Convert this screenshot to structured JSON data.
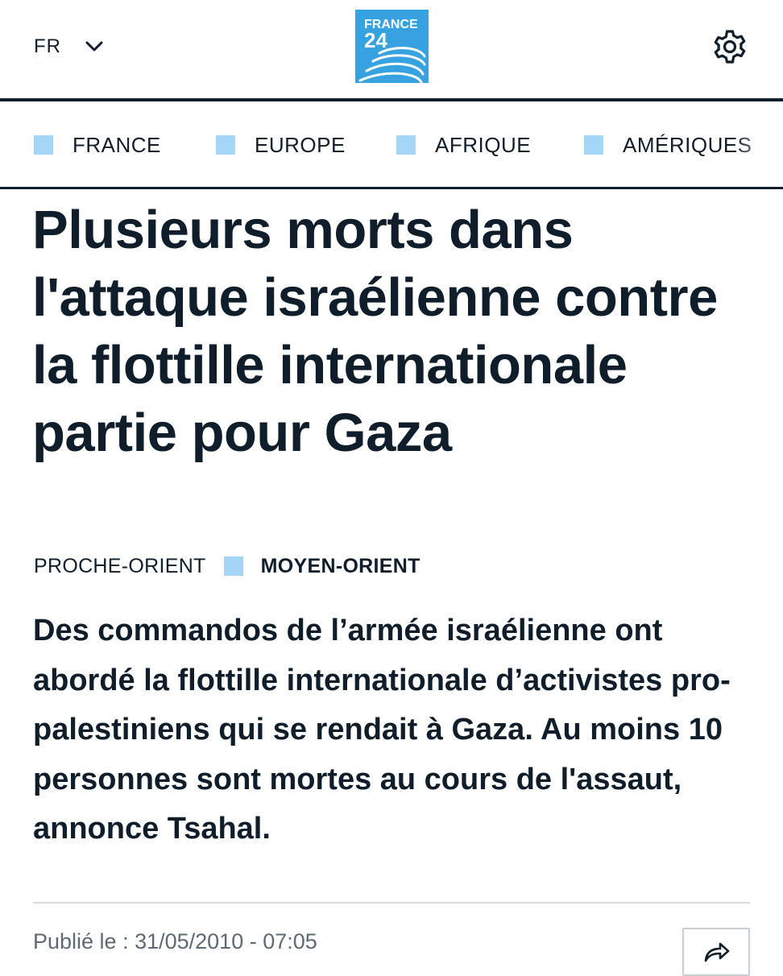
{
  "header": {
    "language": "FR",
    "logo_text_top": "FRANCE",
    "logo_text_bottom": "24",
    "language_icon": "chevron-down-icon",
    "settings_icon": "gear-icon"
  },
  "nav": {
    "items": [
      {
        "label": "FRANCE"
      },
      {
        "label": "EUROPE"
      },
      {
        "label": "AFRIQUE"
      },
      {
        "label": "AMÉRIQUES"
      }
    ]
  },
  "article": {
    "headline": "Plusieurs morts dans l'attaque israélienne contre la flottille internationale partie pour Gaza",
    "category_parent": "PROCHE-ORIENT",
    "category_current": "MOYEN-ORIENT",
    "lead": "Des commandos de l’armée israélienne ont abordé la flottille internationale d’activistes pro-palestiniens qui se rendait à Gaza. Au moins 10 personnes sont mortes au cours de l'assaut, annonce Tsahal.",
    "published_label": "Publié le : 31/05/2010 - 07:05",
    "share_icon": "share-icon"
  },
  "colors": {
    "brand_blue": "#37a2e0",
    "nav_square": "#a5d6f8",
    "text_dark": "#0f1e2a",
    "meta_gray": "#5d6a74"
  }
}
